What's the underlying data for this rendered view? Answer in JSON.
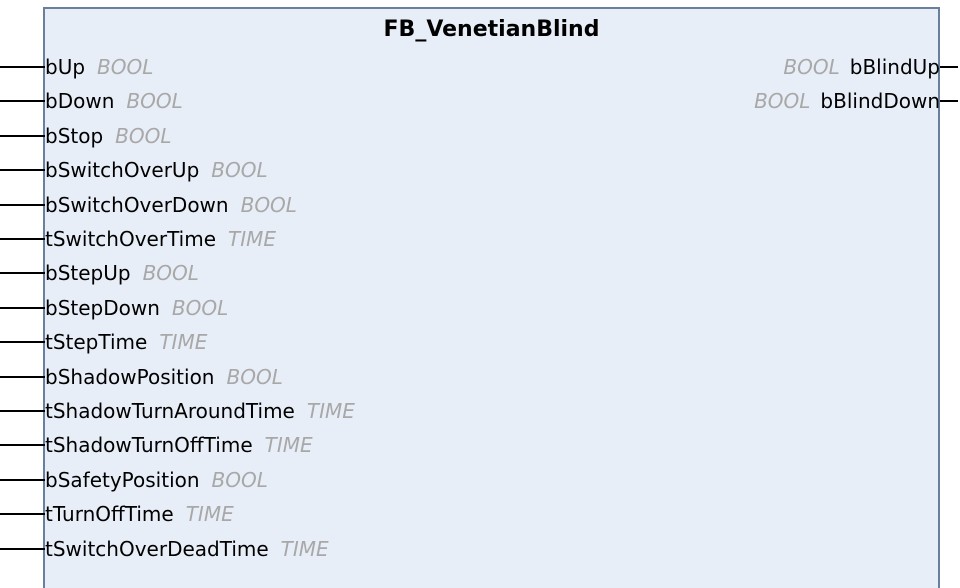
{
  "block": {
    "title": "FB_VenetianBlind"
  },
  "inputs": [
    {
      "name": "bUp",
      "type": "BOOL"
    },
    {
      "name": "bDown",
      "type": "BOOL"
    },
    {
      "name": "bStop",
      "type": "BOOL"
    },
    {
      "name": "bSwitchOverUp",
      "type": "BOOL"
    },
    {
      "name": "bSwitchOverDown",
      "type": "BOOL"
    },
    {
      "name": "tSwitchOverTime",
      "type": "TIME"
    },
    {
      "name": "bStepUp",
      "type": "BOOL"
    },
    {
      "name": "bStepDown",
      "type": "BOOL"
    },
    {
      "name": "tStepTime",
      "type": "TIME"
    },
    {
      "name": "bShadowPosition",
      "type": "BOOL"
    },
    {
      "name": "tShadowTurnAroundTime",
      "type": "TIME"
    },
    {
      "name": "tShadowTurnOffTime",
      "type": "TIME"
    },
    {
      "name": "bSafetyPosition",
      "type": "BOOL"
    },
    {
      "name": "tTurnOffTime",
      "type": "TIME"
    },
    {
      "name": "tSwitchOverDeadTime",
      "type": "TIME"
    }
  ],
  "outputs": [
    {
      "name": "bBlindUp",
      "type": "BOOL"
    },
    {
      "name": "bBlindDown",
      "type": "BOOL"
    }
  ]
}
